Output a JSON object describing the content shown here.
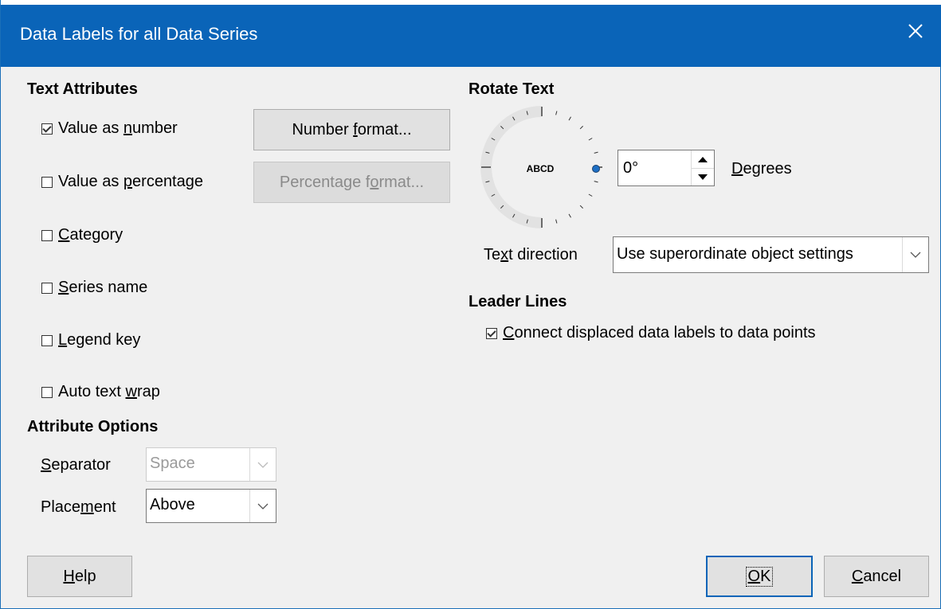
{
  "window": {
    "title": "Data Labels for all Data Series",
    "close_icon": "close-icon"
  },
  "text_attributes": {
    "heading": "Text Attributes",
    "value_as_number": {
      "pre": "Value as ",
      "ul": "n",
      "post": "umber",
      "checked": true
    },
    "value_as_percentage": {
      "pre": "Value as ",
      "ul": "p",
      "post": "ercentage",
      "checked": false
    },
    "category": {
      "pre": "",
      "ul": "C",
      "post": "ategory",
      "checked": false
    },
    "series_name": {
      "pre": "",
      "ul": "S",
      "post": "eries name",
      "checked": false
    },
    "legend_key": {
      "pre": "",
      "ul": "L",
      "post": "egend key",
      "checked": false
    },
    "auto_text_wrap": {
      "pre": "Auto text ",
      "ul": "w",
      "post": "rap",
      "checked": false
    },
    "number_format_button": {
      "pre": "Number ",
      "ul": "f",
      "post": "ormat..."
    },
    "percentage_format_button": {
      "pre": "Percentage f",
      "ul": "o",
      "post": "rmat..."
    }
  },
  "attribute_options": {
    "heading": "Attribute Options",
    "separator": {
      "pre": "",
      "ul": "S",
      "post": "eparator",
      "value": "Space"
    },
    "placement": {
      "pre": "Place",
      "ul": "m",
      "post": "ent",
      "value": "Above"
    }
  },
  "rotate_text": {
    "heading": "Rotate Text",
    "dial_text": "ABCD",
    "degrees_value": "0°",
    "degrees_label": {
      "pre": "",
      "ul": "D",
      "post": "egrees"
    },
    "text_direction_label": {
      "pre": "Te",
      "ul": "x",
      "post": "t direction"
    },
    "text_direction_value": "Use superordinate object settings",
    "indicator_color": "#1e6fc4"
  },
  "leader_lines": {
    "heading": "Leader Lines",
    "connect": {
      "pre": "",
      "ul": "C",
      "post": "onnect displaced data labels to data points",
      "checked": true
    }
  },
  "footer": {
    "help": {
      "pre": "",
      "ul": "H",
      "post": "elp"
    },
    "ok": {
      "pre": "",
      "ul": "O",
      "post": "K"
    },
    "cancel": {
      "pre": "",
      "ul": "C",
      "post": "ancel"
    }
  },
  "colors": {
    "accent": "#0a64b8"
  }
}
